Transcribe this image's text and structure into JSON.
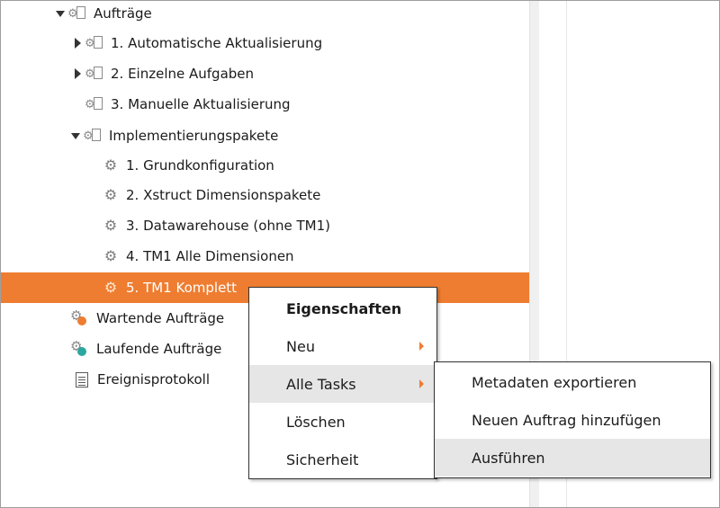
{
  "tree": {
    "root": {
      "label": "Aufträge"
    },
    "items": [
      {
        "label": "1. Automatische Aktualisierung"
      },
      {
        "label": "2. Einzelne Aufgaben"
      },
      {
        "label": "3. Manuelle Aktualisierung"
      },
      {
        "label": "Implementierungspakete"
      },
      {
        "label": "1. Grundkonfiguration"
      },
      {
        "label": "2. Xstruct Dimensionspakete"
      },
      {
        "label": "3. Datawarehouse (ohne TM1)"
      },
      {
        "label": "4. TM1 Alle Dimensionen"
      },
      {
        "label": "5. TM1 Komplett"
      }
    ],
    "bottom": [
      {
        "label": "Wartende Aufträge"
      },
      {
        "label": "Laufende Aufträge"
      },
      {
        "label": "Ereignisprotokoll"
      }
    ]
  },
  "context_menu": {
    "items": [
      {
        "label": "Eigenschaften"
      },
      {
        "label": "Neu"
      },
      {
        "label": "Alle Tasks"
      },
      {
        "label": "Löschen"
      },
      {
        "label": "Sicherheit"
      }
    ]
  },
  "submenu": {
    "items": [
      {
        "label": "Metadaten exportieren"
      },
      {
        "label": "Neuen Auftrag hinzufügen"
      },
      {
        "label": "Ausführen"
      }
    ]
  },
  "colors": {
    "selection": "#ee7d31",
    "menu_highlight": "#e6e6e6",
    "submenu_arrow": "#ee7d31"
  }
}
